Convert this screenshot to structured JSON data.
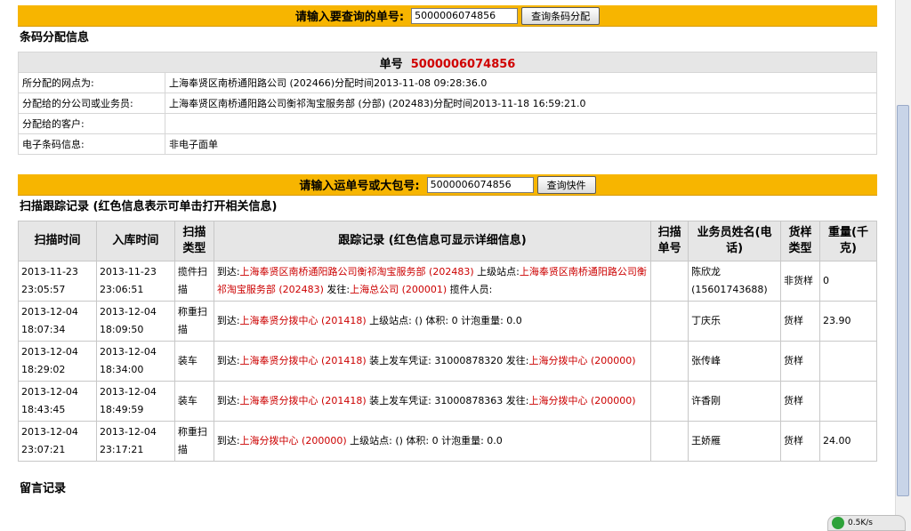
{
  "barcode_query": {
    "label": "请输入要查询的单号:",
    "input_value": "5000006074856",
    "button": "查询条码分配"
  },
  "allocation": {
    "title": "条码分配信息",
    "header_prefix": "单号",
    "waybill": "5000006074856",
    "rows": [
      {
        "key": "所分配的网点为:",
        "value": "上海奉贤区南桥通阳路公司 (202466)分配时间2013-11-08 09:28:36.0"
      },
      {
        "key": "分配给的分公司或业务员:",
        "value": "上海奉贤区南桥通阳路公司衡祁淘宝服务部 (分部) (202483)分配时间2013-11-18 16:59:21.0"
      },
      {
        "key": "分配给的客户:",
        "value": ""
      },
      {
        "key": "电子条码信息:",
        "value": "非电子面单"
      }
    ]
  },
  "tracking_query": {
    "label": "请输入运单号或大包号:",
    "input_value": "5000006074856",
    "button": "查询快件"
  },
  "tracking": {
    "title": "扫描跟踪记录 (红色信息表示可单击打开相关信息)",
    "headers": [
      "扫描时间",
      "入库时间",
      "扫描类型",
      "跟踪记录 (红色信息可显示详细信息)",
      "扫描单号",
      "业务员姓名(电话)",
      "货样类型",
      "重量(千克)"
    ],
    "rows": [
      {
        "scan_time": "2013-11-23 23:05:57",
        "in_time": "2013-11-23 23:06:51",
        "type": "揽件扫描",
        "record": [
          {
            "t": "到达:",
            "red": false
          },
          {
            "t": "上海奉贤区南桥通阳路公司衡祁淘宝服务部 (202483)",
            "red": true
          },
          {
            "t": " 上级站点:",
            "red": false
          },
          {
            "t": "上海奉贤区南桥通阳路公司衡祁淘宝服务部 (202483)",
            "red": true
          },
          {
            "t": " 发往:",
            "red": false
          },
          {
            "t": "上海总公司 (200001)",
            "red": true
          },
          {
            "t": " 揽件人员:",
            "red": false
          }
        ],
        "scan_no": "",
        "staff": "陈欣龙 (15601743688)",
        "sample": "非货样",
        "weight": "0"
      },
      {
        "scan_time": "2013-12-04 18:07:34",
        "in_time": "2013-12-04 18:09:50",
        "type": "称重扫描",
        "record": [
          {
            "t": "到达:",
            "red": false
          },
          {
            "t": "上海奉贤分拨中心 (201418)",
            "red": true
          },
          {
            "t": " 上级站点: () 体积: 0 计泡重量: 0.0",
            "red": false
          }
        ],
        "scan_no": "",
        "staff": "丁庆乐",
        "sample": "货样",
        "weight": "23.90"
      },
      {
        "scan_time": "2013-12-04 18:29:02",
        "in_time": "2013-12-04 18:34:00",
        "type": "装车",
        "record": [
          {
            "t": "到达:",
            "red": false
          },
          {
            "t": "上海奉贤分拨中心 (201418)",
            "red": true
          },
          {
            "t": " 装上发车凭证: 31000878320 发往:",
            "red": false
          },
          {
            "t": "上海分拨中心 (200000)",
            "red": true
          }
        ],
        "scan_no": "",
        "staff": "张传峰",
        "sample": "货样",
        "weight": ""
      },
      {
        "scan_time": "2013-12-04 18:43:45",
        "in_time": "2013-12-04 18:49:59",
        "type": "装车",
        "record": [
          {
            "t": "到达:",
            "red": false
          },
          {
            "t": "上海奉贤分拨中心 (201418)",
            "red": true
          },
          {
            "t": " 装上发车凭证: 31000878363 发往:",
            "red": false
          },
          {
            "t": "上海分拨中心 (200000)",
            "red": true
          }
        ],
        "scan_no": "",
        "staff": "许香刚",
        "sample": "货样",
        "weight": ""
      },
      {
        "scan_time": "2013-12-04 23:07:21",
        "in_time": "2013-12-04 23:17:21",
        "type": "称重扫描",
        "record": [
          {
            "t": "到达:",
            "red": false
          },
          {
            "t": "上海分拨中心 (200000)",
            "red": true
          },
          {
            "t": " 上级站点: () 体积: 0 计泡重量: 0.0",
            "red": false
          }
        ],
        "scan_no": "",
        "staff": "王娇雁",
        "sample": "货样",
        "weight": "24.00"
      }
    ]
  },
  "messages": {
    "title": "留言记录"
  },
  "status_widget": {
    "speed": "0.5K/s"
  },
  "colors": {
    "bar": "#f7b500",
    "accent_red": "#cc0000",
    "header_gray": "#e6e6e6"
  }
}
